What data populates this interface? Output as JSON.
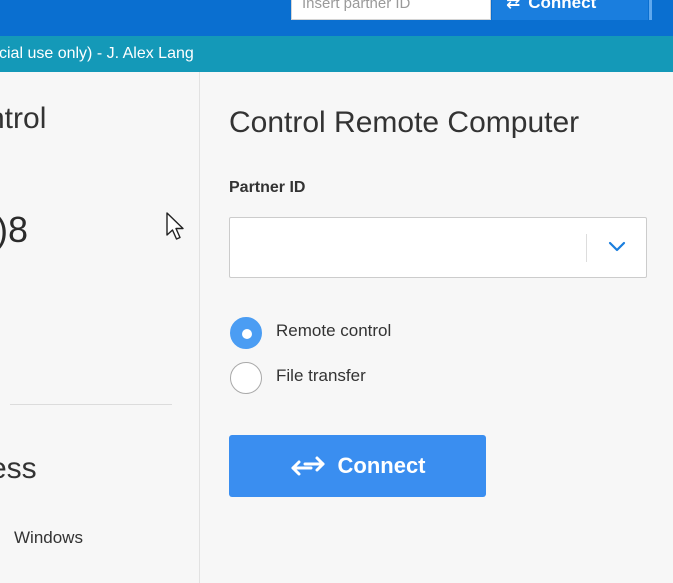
{
  "topbar": {
    "partner_id_placeholder": "Insert partner ID",
    "connect_label": "Connect",
    "connect_icon": "arrows-exchange-icon",
    "background_color": "#0a6fd0"
  },
  "license_bar": {
    "text": "cial use only) - J. Alex Lang",
    "background_color": "#1499b8"
  },
  "left_pane": {
    "section_title": "ntrol",
    "your_id": ")8",
    "section_heading": "ess",
    "sub_item": "Windows"
  },
  "main": {
    "title": "Control Remote Computer",
    "partner_id_label": "Partner ID",
    "partner_id_value": "",
    "dropdown_icon": "chevron-down-icon",
    "options": [
      {
        "label": "Remote control",
        "selected": true
      },
      {
        "label": "File transfer",
        "selected": false
      }
    ],
    "connect_button": {
      "label": "Connect",
      "icon": "arrows-exchange-icon",
      "color": "#3a8ef0"
    }
  },
  "colors": {
    "accent": "#4b9df3",
    "chevron": "#1a7ede"
  }
}
